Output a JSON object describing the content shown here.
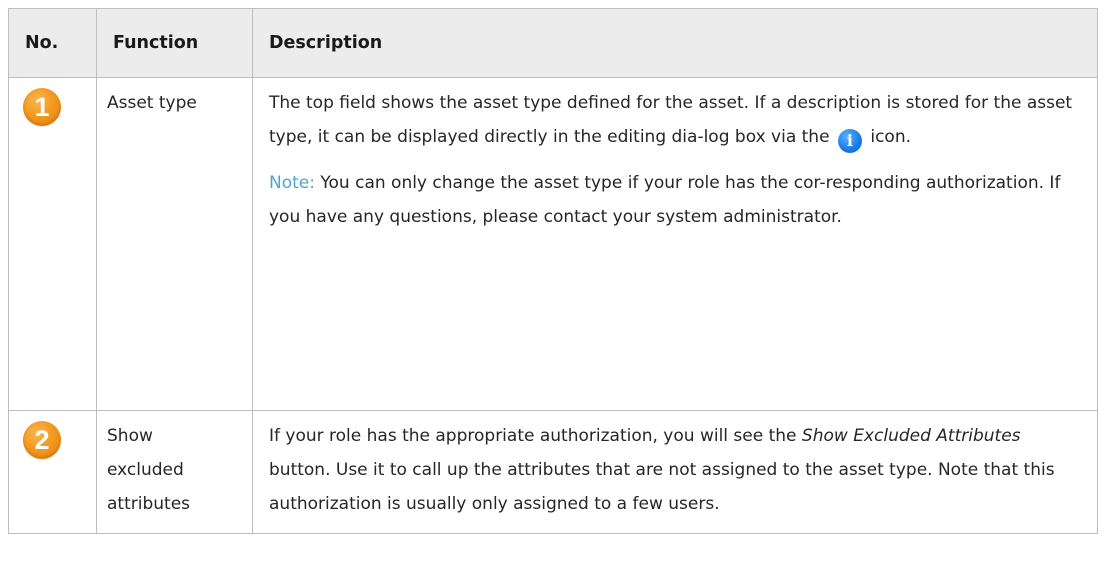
{
  "table": {
    "headers": {
      "no": "No.",
      "function": "Function",
      "description": "Description"
    },
    "rows": [
      {
        "number": "1",
        "function": "Asset type",
        "description_part1": "The top field shows the asset type defined for the asset. If a description is stored for the asset type, it can be displayed directly in the editing dia-log box via the",
        "icon": "info-icon",
        "description_part2": "icon.",
        "note_label": "Note:",
        "note_text": "You can only change the asset type if your role has the cor-responding authorization. If you have any questions, please contact your system administrator."
      },
      {
        "number": "2",
        "function_lines": [
          "Show",
          "excluded",
          "attributes"
        ],
        "description_before": "If your role has the appropriate authorization, you will see the",
        "description_emphasis": "Show Excluded Attributes",
        "description_after": "button. Use it to call up the attributes that are not assigned to the asset type. Note that this authorization is usually only assigned to a few users."
      }
    ]
  },
  "colors": {
    "badge": "#f39a1f",
    "note": "#4ea6c9",
    "info_icon": "#1a7fe8",
    "header_bg": "#ececec",
    "border": "#bdbdbd"
  }
}
